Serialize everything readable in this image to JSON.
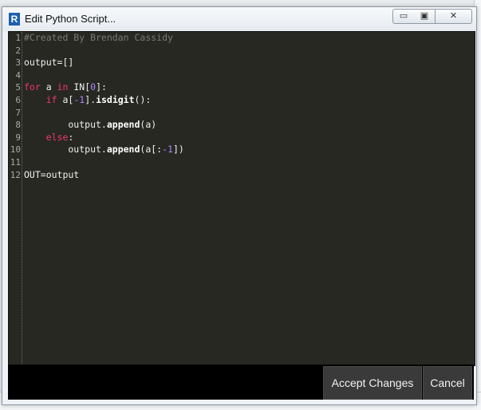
{
  "window": {
    "title": "Edit Python Script...",
    "app_icon_letter": "R",
    "controls": {
      "minimize": "▭",
      "maximize": "▣",
      "close": "✕"
    }
  },
  "editor": {
    "line_numbers": [
      "1",
      "2",
      "3",
      "4",
      "5",
      "6",
      "7",
      "8",
      "9",
      "10",
      "11",
      "12"
    ]
  },
  "footer": {
    "accept_label": "Accept Changes",
    "cancel_label": "Cancel"
  },
  "colors": {
    "editor_bg": "#272822",
    "keyword": "#f2356f",
    "number": "#ae81ff",
    "comment": "#7a7a70",
    "button_bg": "#3a3a3a"
  }
}
